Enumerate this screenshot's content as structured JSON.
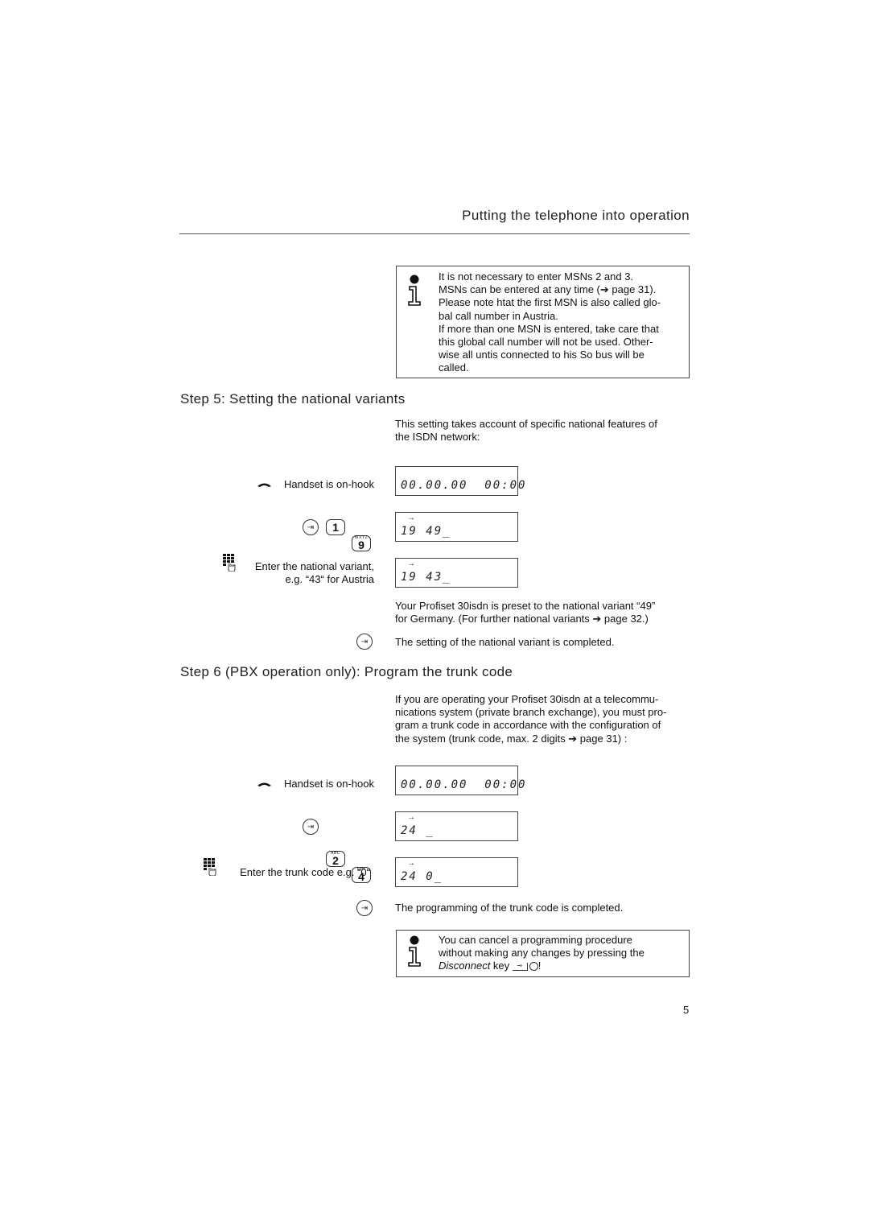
{
  "header": {
    "title": "Putting the telephone into operation"
  },
  "info_box_1": {
    "icon": "info-icon",
    "lines": [
      "It is not necessary to enter MSNs 2 and 3.",
      "MSNs can be entered at any time (➔ page 31).",
      "Please note htat the first MSN is also called glo-",
      "bal call number in Austria.",
      "If more than one MSN is entered, take care that",
      "this global call number will not be used. Other-",
      "wise all untis connected to his So bus will be",
      "called."
    ]
  },
  "step5": {
    "heading": "Step 5: Setting the national variants",
    "intro_lines": [
      "This setting takes account of specific national features of",
      "the ISDN network:"
    ],
    "rows": [
      {
        "icon": "handset-onhook-icon",
        "label": "Handset is on-hook",
        "display": "00.00.00  00:00"
      },
      {
        "icon": "enter-key-icon",
        "keys": [
          {
            "digit": "1",
            "letters": ""
          },
          {
            "digit": "9",
            "letters": "WXYZ"
          }
        ],
        "display_arrow": "→",
        "display": "19 49_"
      },
      {
        "icon": "keypad-icon",
        "label_lines": [
          "Enter the national variant,",
          "e.g. “43“ for Austria"
        ],
        "display_arrow": "→",
        "display": "19 43_"
      }
    ],
    "note_lines": [
      "Your Profiset 30isdn is preset to the national variant “49”",
      "for Germany. (For further national variants ➔ page 32.)"
    ],
    "complete_text": "The setting of the national variant is completed."
  },
  "step6": {
    "heading": "Step 6 (PBX operation only): Program the trunk code",
    "intro_lines": [
      "If you are operating your Profiset 30isdn at a telecommu-",
      "nications system (private branch exchange), you must pro-",
      "gram a trunk code in accordance with the configuration of",
      "the system (trunk code, max. 2 digits ➔ page 31) :"
    ],
    "rows": [
      {
        "icon": "handset-onhook-icon",
        "label": "Handset is on-hook",
        "display": "00.00.00  00:00"
      },
      {
        "icon": "enter-key-icon",
        "keys": [
          {
            "digit": "2",
            "letters": "ABC"
          },
          {
            "digit": "4",
            "letters": "GHI"
          }
        ],
        "display_arrow": "→",
        "display": "24 _"
      },
      {
        "icon": "keypad-icon",
        "label": "Enter the trunk code e.g. “0“",
        "display_arrow": "→",
        "display": "24 0_"
      }
    ],
    "complete_text": "The programming of the trunk code is completed."
  },
  "info_box_2": {
    "icon": "info-icon",
    "line1": "You can cancel a programming procedure",
    "line2": "without making any changes by pressing the",
    "line3_italic": "Disconnect",
    "line3_rest": " key",
    "line3_end": "!"
  },
  "footer": {
    "page_number": "5"
  }
}
